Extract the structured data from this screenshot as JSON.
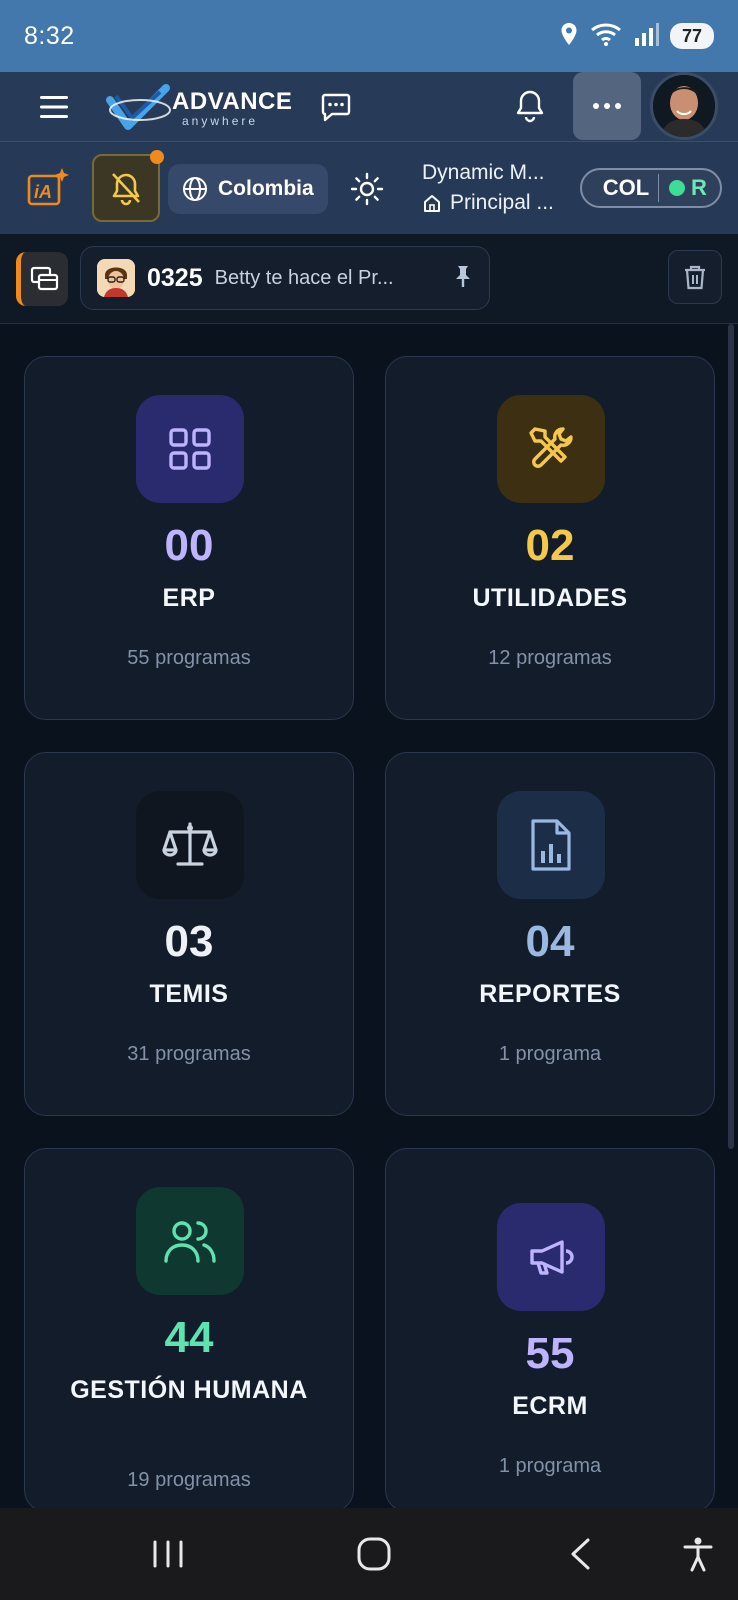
{
  "status_bar": {
    "time": "8:32",
    "battery": "77",
    "icons": [
      "location-icon",
      "wifi-icon",
      "signal-icon"
    ]
  },
  "topbar": {
    "logo_text": "ADVANCE",
    "logo_subtext": "anywhere",
    "icons": [
      "menu-icon",
      "chat-icon",
      "bell-icon",
      "more-icon",
      "avatar"
    ]
  },
  "subbar": {
    "country": "Colombia",
    "company_name": "Dynamic M...",
    "branch": "Principal ...",
    "env_code": "COL",
    "env_mode": "R",
    "icons": [
      "ia-icon",
      "bell-off-icon",
      "globe-icon",
      "sun-icon",
      "home-icon"
    ]
  },
  "tabs": {
    "active_code": "0325",
    "active_title": "Betty te hace el Pr..."
  },
  "modules": [
    {
      "code": "00",
      "name": "ERP",
      "count": "55 programas",
      "icon": "grid-icon",
      "color": "#bdb3ff",
      "bg": "#2a2a6e"
    },
    {
      "code": "02",
      "name": "UTILIDADES",
      "count": "12 programas",
      "icon": "tools-icon",
      "color": "#f5c84a",
      "bg": "#3d2f12"
    },
    {
      "code": "03",
      "name": "TEMIS",
      "count": "31 programas",
      "icon": "scale-icon",
      "color": "#eef2f7",
      "bg": "#0f1620"
    },
    {
      "code": "04",
      "name": "REPORTES",
      "count": "1 programa",
      "icon": "report-icon",
      "color": "#9bb8e0",
      "bg": "#1c2d48"
    },
    {
      "code": "44",
      "name": "GESTIÓN HUMANA",
      "count": "19 programas",
      "icon": "users-icon",
      "color": "#5ee3b0",
      "bg": "#0f3830"
    },
    {
      "code": "55",
      "name": "ECRM",
      "count": "1 programa",
      "icon": "megaphone-icon",
      "color": "#bdb3ff",
      "bg": "#2a2a6e"
    }
  ],
  "navbar": {
    "icons": [
      "recent-apps-icon",
      "home-nav-icon",
      "back-icon",
      "accessibility-icon"
    ]
  }
}
